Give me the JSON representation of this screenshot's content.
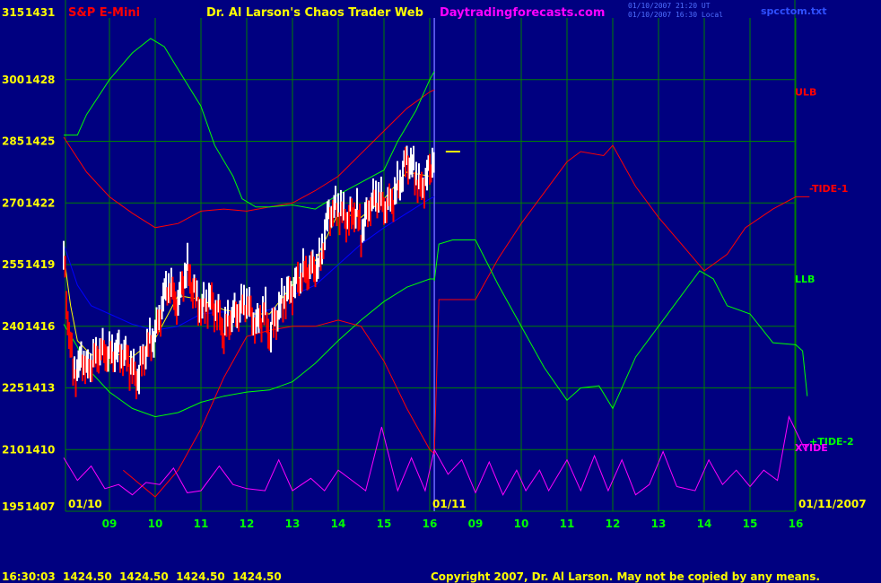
{
  "header": {
    "instrument": "S&P E-Mini",
    "title": "Dr. Al Larson's Chaos Trader Web",
    "website": "Daytradingforecasts.com",
    "timestamp_line1": "01/10/2007 21:20 UT",
    "timestamp_line2": "01/10/2007 16:30 Local",
    "filename": "spcctom.txt"
  },
  "footer": {
    "quote": "16:30:03  1424.50  1424.50  1424.50  1424.50",
    "copyright": "Copyright 2007, Dr. Al Larson. May not be copied by any means."
  },
  "colors": {
    "background": "#000080",
    "grid": "#008000",
    "price_up": "#ffffff",
    "price_down": "#ff0000",
    "ulb": "#ff0000",
    "llb": "#00ff00",
    "blue_ma": "#0000ff",
    "yellow_ma": "#ffff00",
    "tide1": "#ff0000",
    "tide2": "#00ff00",
    "xtide": "#ff00ff",
    "date_divider": "#6a6aff"
  },
  "chart_data": {
    "type": "line",
    "price_range": [
      1407,
      1431
    ],
    "tick_range": [
      195,
      315
    ],
    "y_ticks": [
      {
        "ticks": "315",
        "price": "1431"
      },
      {
        "ticks": "300",
        "price": "1428"
      },
      {
        "ticks": "285",
        "price": "1425"
      },
      {
        "ticks": "270",
        "price": "1422"
      },
      {
        "ticks": "255",
        "price": "1419"
      },
      {
        "ticks": "240",
        "price": "1416"
      },
      {
        "ticks": "225",
        "price": "1413"
      },
      {
        "ticks": "210",
        "price": "1410"
      },
      {
        "ticks": "195",
        "price": "1407"
      }
    ],
    "x_range": [
      8.0,
      24.3
    ],
    "x_ticks": [
      {
        "x": 9,
        "label": "09"
      },
      {
        "x": 10,
        "label": "10"
      },
      {
        "x": 11,
        "label": "11"
      },
      {
        "x": 12,
        "label": "12"
      },
      {
        "x": 13,
        "label": "13"
      },
      {
        "x": 14,
        "label": "14"
      },
      {
        "x": 15,
        "label": "15"
      },
      {
        "x": 16,
        "label": "16"
      },
      {
        "x": 17,
        "label": "09"
      },
      {
        "x": 18,
        "label": "10"
      },
      {
        "x": 19,
        "label": "11"
      },
      {
        "x": 20,
        "label": "12"
      },
      {
        "x": 21,
        "label": "13"
      },
      {
        "x": 22,
        "label": "14"
      },
      {
        "x": 23,
        "label": "15"
      },
      {
        "x": 24,
        "label": "16"
      }
    ],
    "date_labels": {
      "day1": "01/10",
      "day2": "01/11",
      "end": "01/11/2007"
    },
    "day_divider_x": 16.1,
    "series": [
      {
        "name": "ULB",
        "color": "#ff0000",
        "points": [
          [
            8,
            1425.2
          ],
          [
            8.5,
            1423.5
          ],
          [
            9,
            1422.3
          ],
          [
            9.5,
            1421.5
          ],
          [
            10,
            1420.8
          ],
          [
            10.5,
            1421.0
          ],
          [
            11,
            1421.6
          ],
          [
            11.5,
            1421.7
          ],
          [
            12,
            1421.6
          ],
          [
            12.5,
            1421.8
          ],
          [
            13,
            1422.0
          ],
          [
            13.5,
            1422.6
          ],
          [
            14,
            1423.3
          ],
          [
            14.5,
            1424.4
          ],
          [
            15,
            1425.5
          ],
          [
            15.5,
            1426.6
          ],
          [
            16,
            1427.4
          ],
          [
            16.1,
            1427.5
          ]
        ]
      },
      {
        "name": "LLB",
        "color": "#00ff00",
        "points": [
          [
            8,
            1416.1
          ],
          [
            8.3,
            1415.0
          ],
          [
            8.5,
            1414.0
          ],
          [
            9,
            1412.8
          ],
          [
            9.5,
            1412.0
          ],
          [
            10,
            1411.6
          ],
          [
            10.5,
            1411.8
          ],
          [
            11,
            1412.3
          ],
          [
            11.5,
            1412.6
          ],
          [
            12,
            1412.8
          ],
          [
            12.5,
            1412.9
          ],
          [
            13,
            1413.3
          ],
          [
            13.5,
            1414.2
          ],
          [
            14,
            1415.3
          ],
          [
            14.5,
            1416.3
          ],
          [
            15,
            1417.2
          ],
          [
            15.5,
            1417.9
          ],
          [
            16,
            1418.3
          ],
          [
            16.1,
            1418.3
          ]
        ]
      },
      {
        "name": "Green upper band",
        "color": "#00ff00",
        "points": [
          [
            8,
            1425.3
          ],
          [
            8.3,
            1425.3
          ],
          [
            8.5,
            1426.3
          ],
          [
            9,
            1428.0
          ],
          [
            9.5,
            1429.3
          ],
          [
            9.9,
            1430.0
          ],
          [
            10.2,
            1429.6
          ],
          [
            10.5,
            1428.5
          ],
          [
            11,
            1426.7
          ],
          [
            11.3,
            1424.8
          ],
          [
            11.7,
            1423.3
          ],
          [
            11.9,
            1422.2
          ],
          [
            12.2,
            1421.8
          ],
          [
            12.5,
            1421.8
          ],
          [
            13,
            1421.9
          ],
          [
            13.5,
            1421.7
          ],
          [
            14,
            1422.4
          ],
          [
            14.5,
            1423.0
          ],
          [
            15,
            1423.6
          ],
          [
            15.3,
            1425.0
          ],
          [
            15.7,
            1426.5
          ],
          [
            16,
            1428.0
          ],
          [
            16.1,
            1428.4
          ]
        ]
      },
      {
        "name": "Blue MA",
        "color": "#0000ff",
        "points": [
          [
            8,
            1420.0
          ],
          [
            8.3,
            1418.0
          ],
          [
            8.6,
            1417.0
          ],
          [
            9,
            1416.6
          ],
          [
            9.5,
            1416.1
          ],
          [
            10,
            1415.8
          ],
          [
            10.5,
            1416.0
          ],
          [
            11,
            1416.6
          ],
          [
            11.5,
            1416.7
          ],
          [
            12,
            1416.6
          ],
          [
            12.5,
            1416.8
          ],
          [
            13,
            1417.5
          ],
          [
            13.5,
            1418.0
          ],
          [
            14,
            1419.0
          ],
          [
            14.5,
            1420.0
          ],
          [
            15,
            1420.8
          ],
          [
            15.5,
            1421.5
          ],
          [
            16,
            1422.2
          ],
          [
            16.1,
            1422.3
          ]
        ]
      },
      {
        "name": "Yellow MA",
        "color": "#ffff00",
        "points": [
          [
            8,
            1419.5
          ],
          [
            8.15,
            1417.0
          ],
          [
            8.3,
            1415.3
          ],
          [
            8.6,
            1414.6
          ],
          [
            9,
            1414.7
          ],
          [
            9.5,
            1414.5
          ],
          [
            10,
            1415.4
          ],
          [
            10.5,
            1417.5
          ],
          [
            11,
            1417.3
          ],
          [
            11.5,
            1416.8
          ],
          [
            12,
            1416.6
          ],
          [
            12.5,
            1416.6
          ],
          [
            13,
            1418.0
          ],
          [
            13.5,
            1419.2
          ],
          [
            14,
            1421.5
          ],
          [
            14.5,
            1421.3
          ],
          [
            15,
            1422.2
          ],
          [
            15.5,
            1423.5
          ],
          [
            16,
            1423.3
          ],
          [
            16.1,
            1423.8
          ]
        ]
      },
      {
        "name": "TIDE-1",
        "color": "#ff0000",
        "points": [
          [
            9.3,
            1409.0
          ],
          [
            10,
            1407.7
          ],
          [
            10.5,
            1409.0
          ],
          [
            11,
            1411.0
          ],
          [
            11.5,
            1413.5
          ],
          [
            12,
            1415.5
          ],
          [
            12.5,
            1415.8
          ],
          [
            13,
            1416.0
          ],
          [
            13.5,
            1416.0
          ],
          [
            14,
            1416.3
          ],
          [
            14.5,
            1416.0
          ],
          [
            15,
            1414.3
          ],
          [
            15.5,
            1412.0
          ],
          [
            16,
            1410.0
          ],
          [
            16.1,
            1409.8
          ],
          [
            16.2,
            1417.3
          ],
          [
            17,
            1417.3
          ],
          [
            17.5,
            1419.3
          ],
          [
            18,
            1421.0
          ],
          [
            18.5,
            1422.5
          ],
          [
            19,
            1424.0
          ],
          [
            19.3,
            1424.5
          ],
          [
            19.8,
            1424.3
          ],
          [
            20,
            1424.8
          ],
          [
            20.5,
            1422.8
          ],
          [
            21,
            1421.3
          ],
          [
            21.5,
            1420.0
          ],
          [
            22,
            1418.7
          ],
          [
            22.5,
            1419.5
          ],
          [
            22.9,
            1420.8
          ],
          [
            23.5,
            1421.7
          ],
          [
            24,
            1422.3
          ],
          [
            24.3,
            1422.3
          ]
        ]
      },
      {
        "name": "TIDE-2",
        "color": "#00ff00",
        "points": [
          [
            16.1,
            1418.2
          ],
          [
            16.2,
            1420.0
          ],
          [
            16.5,
            1420.2
          ],
          [
            17,
            1420.2
          ],
          [
            17.5,
            1418.0
          ],
          [
            18,
            1416.0
          ],
          [
            18.5,
            1414.0
          ],
          [
            19,
            1412.4
          ],
          [
            19.3,
            1413.0
          ],
          [
            19.7,
            1413.1
          ],
          [
            20,
            1412.0
          ],
          [
            20.5,
            1414.5
          ],
          [
            21,
            1416.0
          ],
          [
            21.5,
            1417.5
          ],
          [
            21.9,
            1418.7
          ],
          [
            22.2,
            1418.3
          ],
          [
            22.5,
            1417.0
          ],
          [
            23,
            1416.6
          ],
          [
            23.5,
            1415.2
          ],
          [
            24,
            1415.1
          ],
          [
            24.15,
            1414.8
          ],
          [
            24.25,
            1412.6
          ]
        ]
      },
      {
        "name": "XTIDE",
        "color": "#ff00ff",
        "points": [
          [
            8,
            1409.6
          ],
          [
            8.3,
            1408.5
          ],
          [
            8.6,
            1409.2
          ],
          [
            8.9,
            1408.1
          ],
          [
            9.2,
            1408.3
          ],
          [
            9.5,
            1407.8
          ],
          [
            9.8,
            1408.4
          ],
          [
            10.1,
            1408.3
          ],
          [
            10.4,
            1409.1
          ],
          [
            10.7,
            1407.9
          ],
          [
            11,
            1408.0
          ],
          [
            11.4,
            1409.2
          ],
          [
            11.7,
            1408.3
          ],
          [
            12,
            1408.1
          ],
          [
            12.4,
            1408.0
          ],
          [
            12.7,
            1409.5
          ],
          [
            13,
            1408.0
          ],
          [
            13.4,
            1408.6
          ],
          [
            13.7,
            1408.0
          ],
          [
            14,
            1409.0
          ],
          [
            14.3,
            1408.5
          ],
          [
            14.6,
            1408.0
          ],
          [
            14.95,
            1411.1
          ],
          [
            15.3,
            1408.0
          ],
          [
            15.6,
            1409.6
          ],
          [
            15.9,
            1408.0
          ],
          [
            16.1,
            1410.0
          ],
          [
            16.4,
            1408.8
          ],
          [
            16.7,
            1409.5
          ],
          [
            17,
            1407.9
          ],
          [
            17.3,
            1409.4
          ],
          [
            17.6,
            1407.8
          ],
          [
            17.9,
            1409.0
          ],
          [
            18.1,
            1408.0
          ],
          [
            18.4,
            1409.0
          ],
          [
            18.6,
            1408.0
          ],
          [
            19,
            1409.5
          ],
          [
            19.3,
            1408.0
          ],
          [
            19.6,
            1409.7
          ],
          [
            19.9,
            1408.0
          ],
          [
            20.2,
            1409.5
          ],
          [
            20.5,
            1407.8
          ],
          [
            20.8,
            1408.3
          ],
          [
            21.1,
            1409.9
          ],
          [
            21.4,
            1408.2
          ],
          [
            21.8,
            1408.0
          ],
          [
            22.1,
            1409.5
          ],
          [
            22.4,
            1408.3
          ],
          [
            22.7,
            1409.0
          ],
          [
            23.0,
            1408.2
          ],
          [
            23.3,
            1409.0
          ],
          [
            23.6,
            1408.5
          ],
          [
            23.85,
            1411.6
          ],
          [
            24.2,
            1410.0
          ],
          [
            24.3,
            1410.3
          ]
        ]
      }
    ],
    "price_path": [
      [
        8,
        1419.4
      ],
      [
        8.1,
        1416.0
      ],
      [
        8.2,
        1414.0
      ],
      [
        8.3,
        1413.7
      ],
      [
        8.4,
        1414.6
      ],
      [
        8.5,
        1413.8
      ],
      [
        8.6,
        1414.2
      ],
      [
        8.8,
        1414.8
      ],
      [
        9.0,
        1414.6
      ],
      [
        9.2,
        1414.8
      ],
      [
        9.4,
        1414.4
      ],
      [
        9.6,
        1413.4
      ],
      [
        9.8,
        1414.9
      ],
      [
        10.0,
        1415.6
      ],
      [
        10.1,
        1416.5
      ],
      [
        10.2,
        1417.5
      ],
      [
        10.3,
        1418.0
      ],
      [
        10.4,
        1417.5
      ],
      [
        10.5,
        1417.0
      ],
      [
        10.6,
        1418.2
      ],
      [
        10.7,
        1418.8
      ],
      [
        10.8,
        1418.0
      ],
      [
        11.0,
        1416.8
      ],
      [
        11.2,
        1417.3
      ],
      [
        11.4,
        1416.5
      ],
      [
        11.5,
        1415.6
      ],
      [
        11.6,
        1416.3
      ],
      [
        11.8,
        1416.7
      ],
      [
        12.0,
        1417.2
      ],
      [
        12.2,
        1416.0
      ],
      [
        12.4,
        1416.8
      ],
      [
        12.5,
        1415.5
      ],
      [
        12.6,
        1416.2
      ],
      [
        12.8,
        1417.3
      ],
      [
        13.0,
        1417.8
      ],
      [
        13.2,
        1418.5
      ],
      [
        13.4,
        1418.8
      ],
      [
        13.6,
        1419.0
      ],
      [
        13.7,
        1420.5
      ],
      [
        13.8,
        1421.5
      ],
      [
        14.0,
        1421.8
      ],
      [
        14.2,
        1421.2
      ],
      [
        14.4,
        1421.7
      ],
      [
        14.5,
        1420.5
      ],
      [
        14.7,
        1422.0
      ],
      [
        14.9,
        1422.3
      ],
      [
        15.0,
        1421.8
      ],
      [
        15.2,
        1422.2
      ],
      [
        15.4,
        1423.3
      ],
      [
        15.5,
        1424.2
      ],
      [
        15.7,
        1423.4
      ],
      [
        15.8,
        1422.6
      ],
      [
        16.0,
        1423.6
      ],
      [
        16.1,
        1424.4
      ]
    ],
    "last_price": 1424.5,
    "right_labels": [
      {
        "name": "ULB",
        "price": 1427.4,
        "color": "#ff0000"
      },
      {
        "name": "-TIDE-1",
        "price": 1422.7,
        "color": "#ff0000"
      },
      {
        "name": "LLB",
        "price": 1418.3,
        "color": "#00ff00"
      },
      {
        "name": "+TIDE-2",
        "price": 1410.4,
        "color": "#00ff00"
      },
      {
        "name": "XTIDE",
        "price": 1410.1,
        "color": "#ff00ff"
      }
    ]
  }
}
